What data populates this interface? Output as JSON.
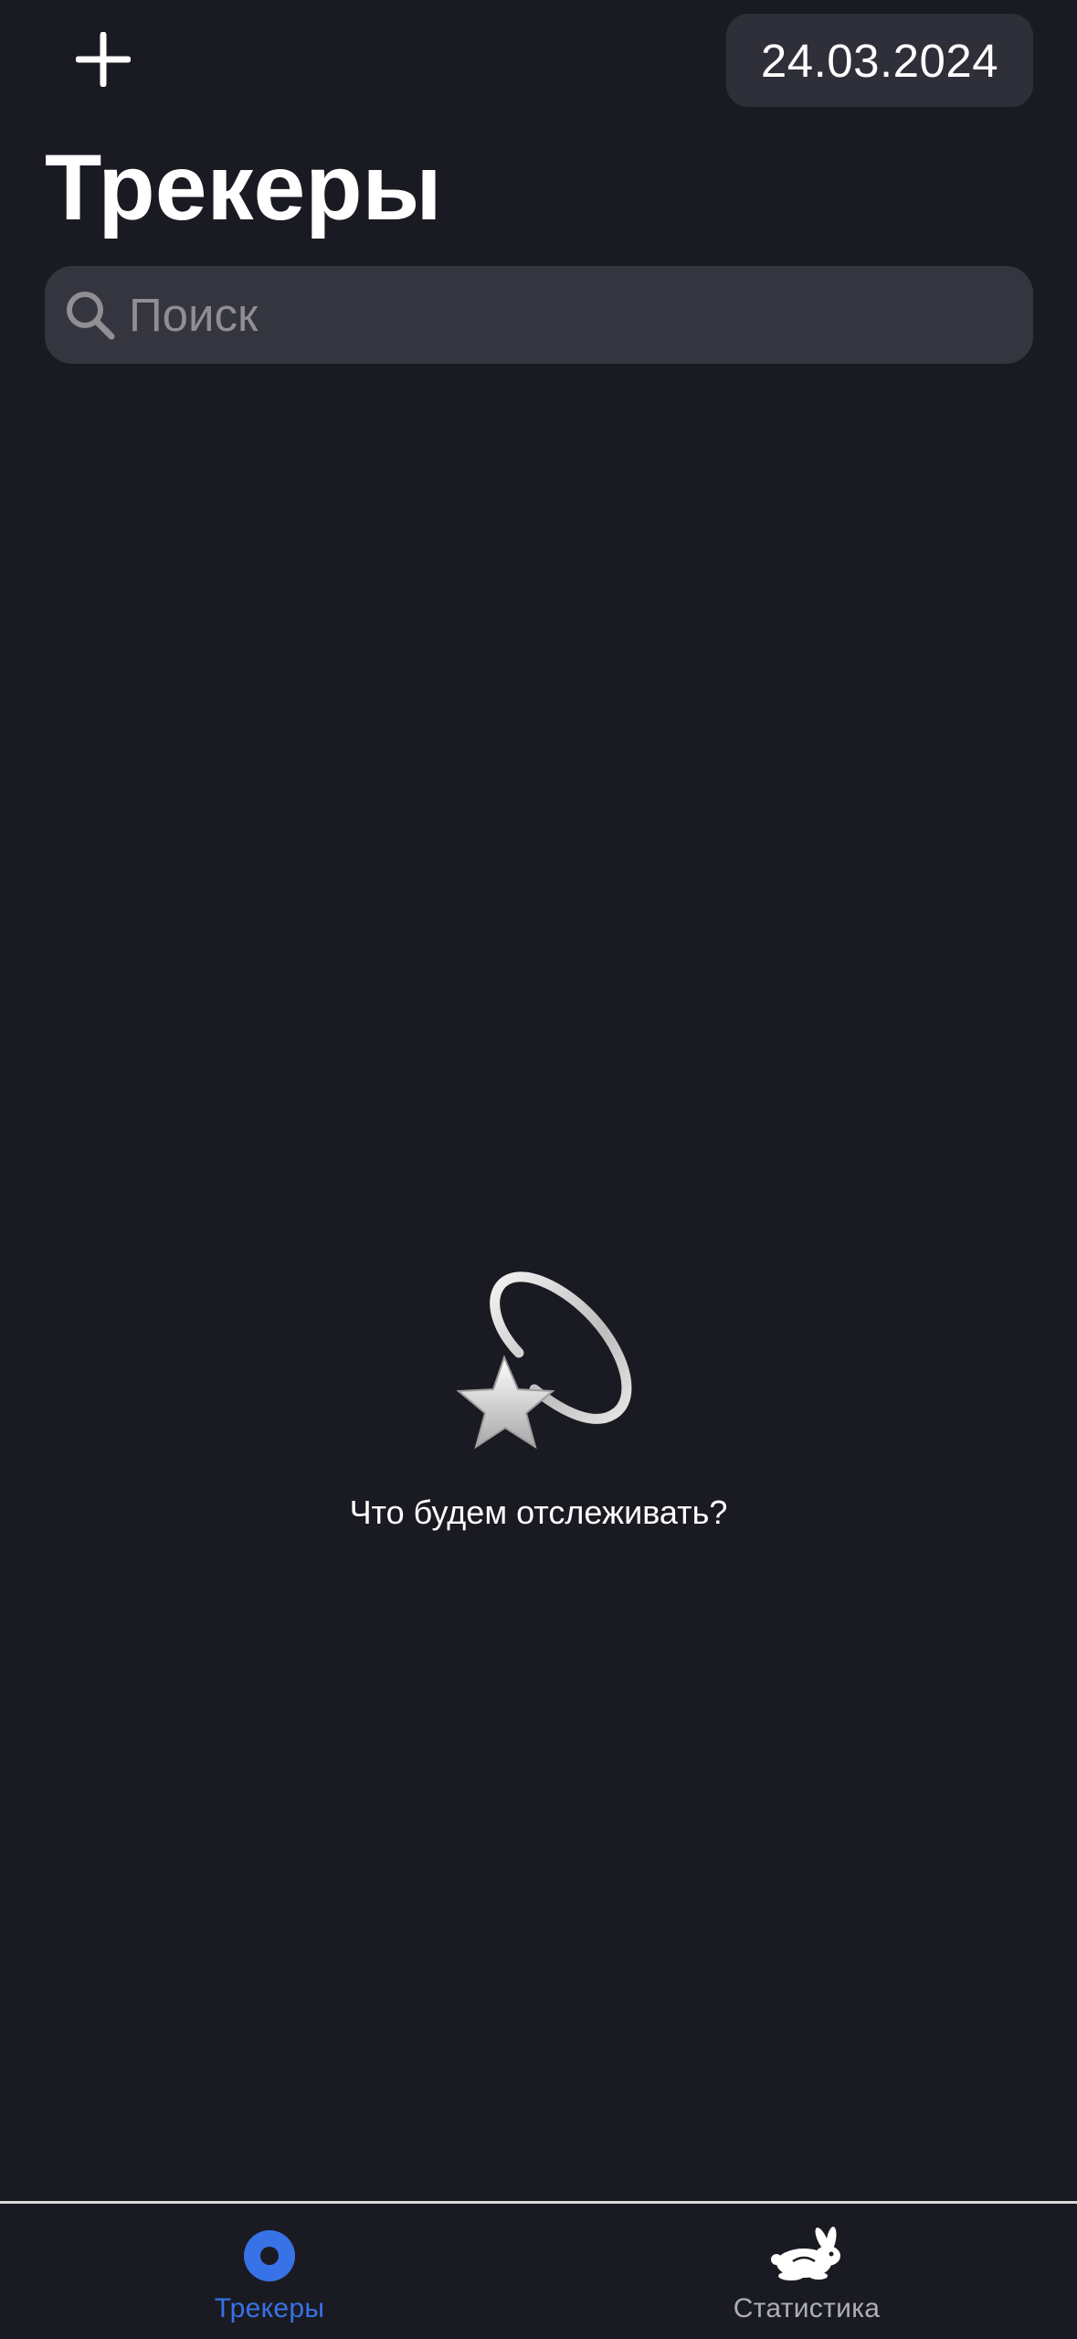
{
  "header": {
    "add_icon": "plus-icon",
    "date": "24.03.2024"
  },
  "title": "Трекеры",
  "search": {
    "icon": "magnifying-glass-icon",
    "placeholder": "Поиск",
    "value": ""
  },
  "empty_state": {
    "illustration": "dizzy-star-icon",
    "message": "Что будем отслеживать?"
  },
  "tab_bar": {
    "tabs": [
      {
        "label": "Трекеры",
        "icon": "record-circle-icon",
        "active": true,
        "color": "#3772E7"
      },
      {
        "label": "Статистика",
        "icon": "hare-icon",
        "active": false,
        "color": "#AEAFB4"
      }
    ]
  },
  "colors": {
    "background": "#1A1B22",
    "search_background": "#34353E",
    "date_background": "#2E2F38",
    "accent": "#3772E7",
    "text_primary": "#FFFFFF",
    "text_secondary": "#8E8E93"
  }
}
